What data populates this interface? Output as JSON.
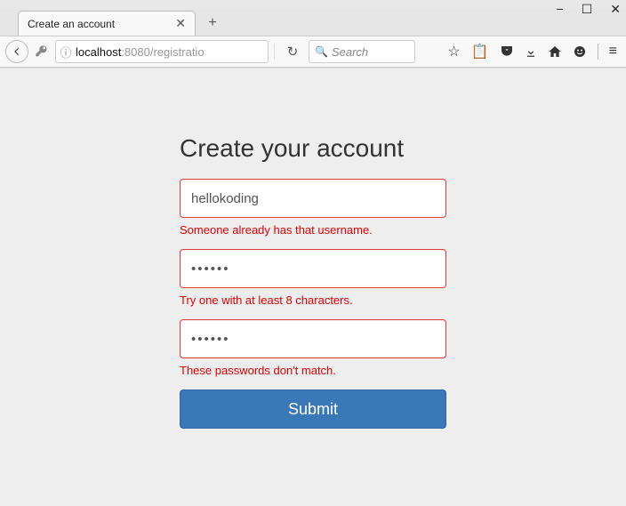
{
  "window": {
    "controls": {
      "min": "−",
      "max": "☐",
      "close": "✕"
    }
  },
  "tab": {
    "title": "Create an account",
    "close_glyph": "✕",
    "new_glyph": "+"
  },
  "nav": {
    "back_glyph": "←",
    "info_glyph": "ⓘ",
    "reload_glyph": "↻"
  },
  "addressbar": {
    "host": "localhost",
    "port": ":8080",
    "path": "/registratio"
  },
  "searchbar": {
    "placeholder": "Search",
    "glass": "🔍"
  },
  "toolbar": {
    "star": "☆",
    "clipboard": "📋",
    "pocket": "⌄",
    "download": "↓",
    "home": "⌂",
    "chat": "☻",
    "menu": "≡"
  },
  "form": {
    "heading": "Create your account",
    "username": {
      "value": "hellokoding",
      "error": "Someone already has that username."
    },
    "password": {
      "value": "••••••",
      "error": "Try one with at least 8 characters."
    },
    "confirm": {
      "value": "••••••",
      "error": "These passwords don't match."
    },
    "submit_label": "Submit"
  }
}
